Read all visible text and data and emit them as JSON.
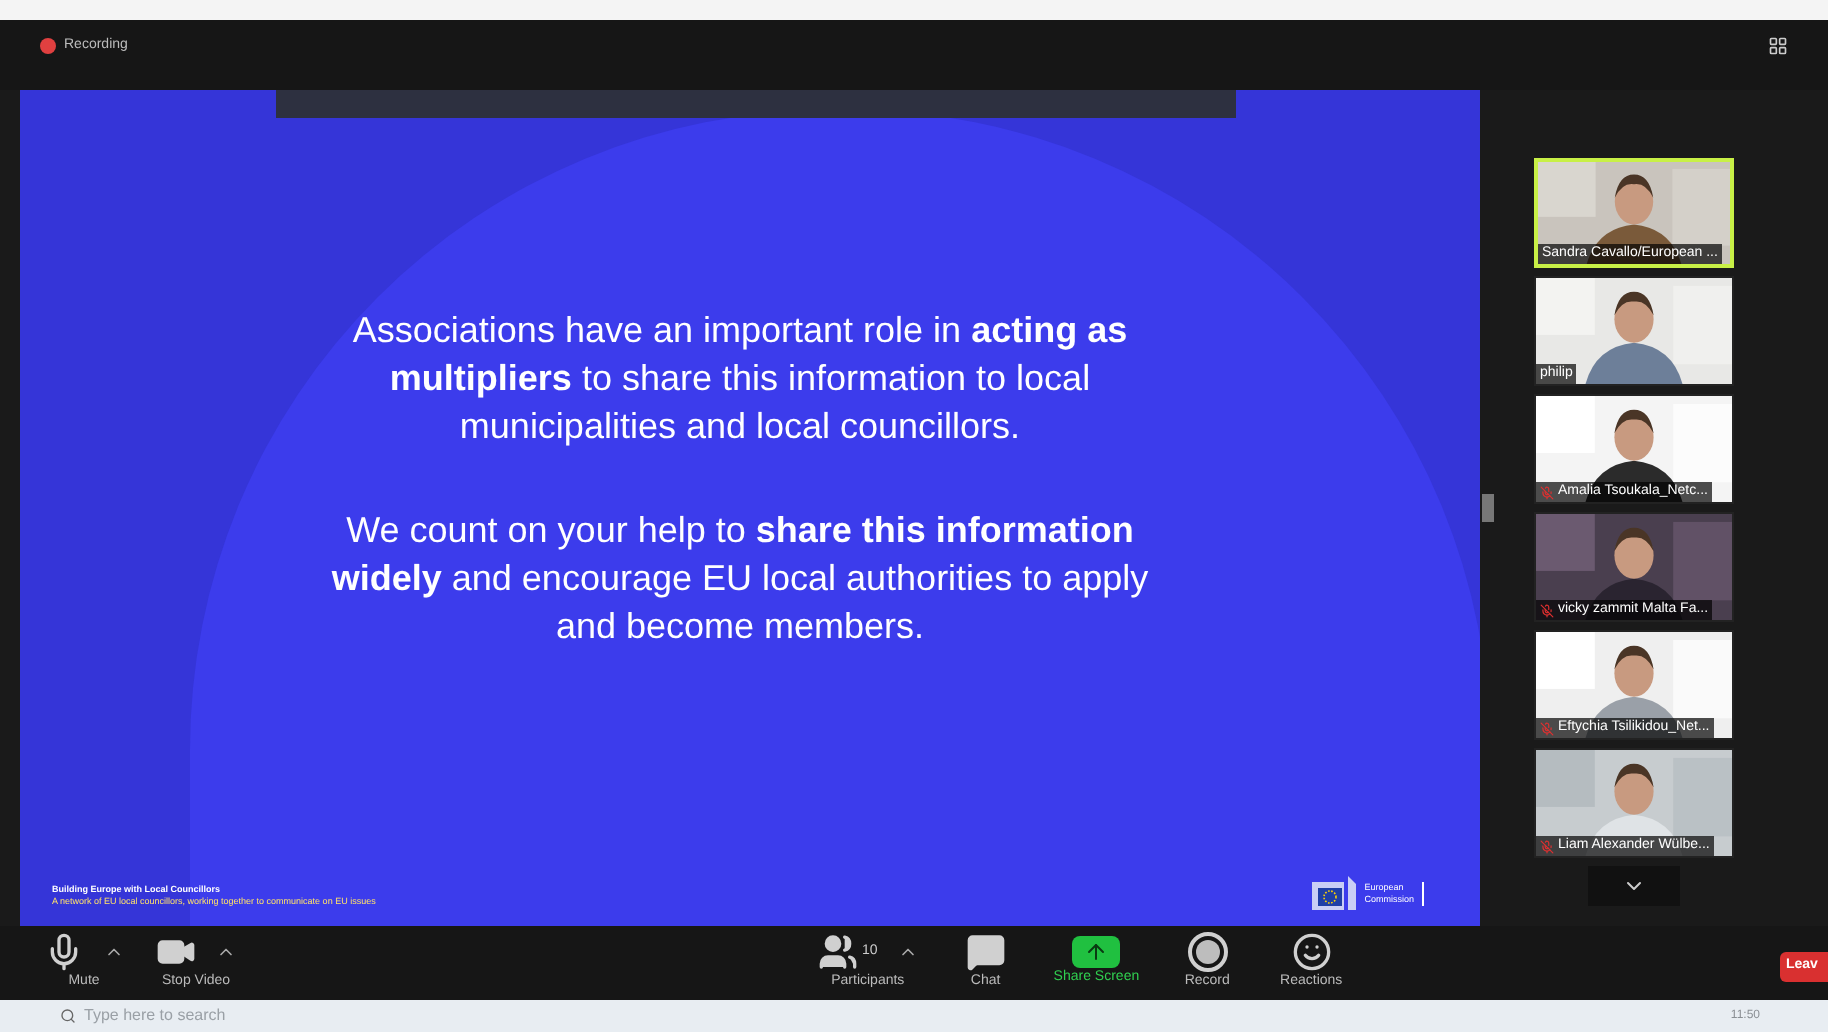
{
  "window": {
    "recording_label": "Recording"
  },
  "slide": {
    "paragraphs": [
      "Associations have an important role in **acting as multipliers** to share this information to local municipalities and local councillors.",
      "We count on your help to **share this information widely** and encourage EU local authorities to apply and become members."
    ],
    "footer_title": "Building Europe with Local Councillors",
    "footer_subtitle": "A network of EU local councillors, working together to communicate on EU issues",
    "logo_lines": [
      "European",
      "Commission"
    ]
  },
  "participants": [
    {
      "name": "Sandra Cavallo/European ...",
      "muted": false,
      "selected": true
    },
    {
      "name": "philip",
      "muted": false,
      "selected": false
    },
    {
      "name": "Amalia Tsoukala_Netc...",
      "muted": true,
      "selected": false
    },
    {
      "name": "vicky zammit Malta Fa...",
      "muted": true,
      "selected": false
    },
    {
      "name": "Eftychia Tsilikidou_Net...",
      "muted": true,
      "selected": false
    },
    {
      "name": "Liam Alexander Wülbe...",
      "muted": true,
      "selected": false
    }
  ],
  "toolbar": [
    {
      "kind": "mic",
      "label": "Mute",
      "caret": true
    },
    {
      "kind": "video",
      "label": "Stop Video",
      "caret": true
    },
    {
      "kind": "participants",
      "label": "Participants",
      "count": "10",
      "caret": true
    },
    {
      "kind": "chat",
      "label": "Chat",
      "caret": false
    },
    {
      "kind": "share",
      "label": "Share Screen",
      "caret": false
    },
    {
      "kind": "record",
      "label": "Record",
      "caret": false
    },
    {
      "kind": "reactions",
      "label": "Reactions",
      "caret": false
    }
  ],
  "leave_button": "Leav",
  "taskbar": {
    "search": {
      "placeholder": "Type here to search"
    },
    "clock": "11:50"
  }
}
